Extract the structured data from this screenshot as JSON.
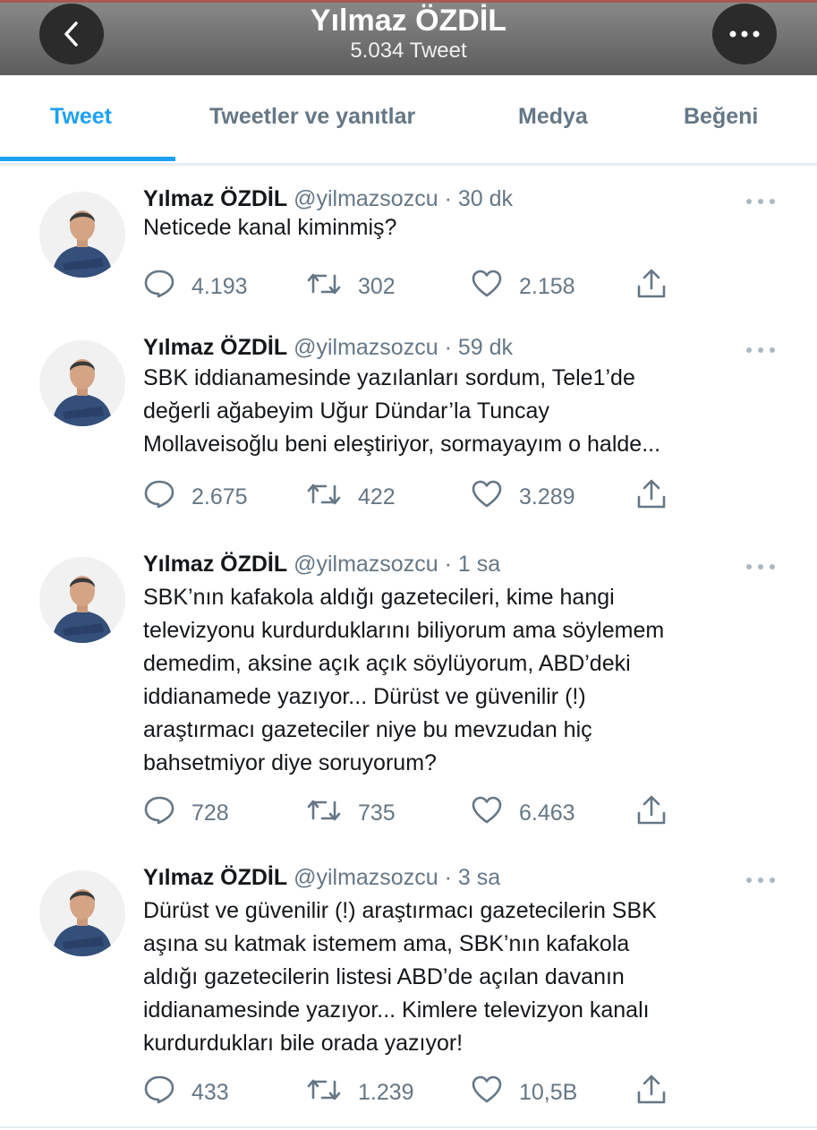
{
  "header": {
    "title": "Yılmaz ÖZDİL",
    "subtitle": "5.034 Tweet"
  },
  "tabs": [
    "Tweet",
    "Tweetler ve yanıtlar",
    "Medya",
    "Beğeni"
  ],
  "tweets": [
    {
      "name": "Yılmaz ÖZDİL",
      "handle": "@yilmazsozcu",
      "time": "30 dk",
      "lines": [
        "Neticede kanal kiminmiş?"
      ],
      "replies": "4.193",
      "retweets": "302",
      "likes": "2.158"
    },
    {
      "name": "Yılmaz ÖZDİL",
      "handle": "@yilmazsozcu",
      "time": "59 dk",
      "lines": [
        "SBK iddianamesinde yazılanları sordum, Tele1’de",
        "değerli ağabeyim Uğur Dündar’la Tuncay",
        "Mollaveisoğlu beni eleştiriyor, sormayayım o halde..."
      ],
      "replies": "2.675",
      "retweets": "422",
      "likes": "3.289"
    },
    {
      "name": "Yılmaz ÖZDİL",
      "handle": "@yilmazsozcu",
      "time": "1 sa",
      "lines": [
        "SBK’nın kafakola aldığı gazetecileri, kime hangi",
        "televizyonu kurdurduklarını biliyorum ama söylemem",
        "demedim, aksine açık açık söylüyorum, ABD’deki",
        "iddianamede yazıyor... Dürüst ve güvenilir (!)",
        "araştırmacı gazeteciler niye bu mevzudan hiç",
        "bahsetmiyor diye soruyorum?"
      ],
      "replies": "728",
      "retweets": "735",
      "likes": "6.463"
    },
    {
      "name": "Yılmaz ÖZDİL",
      "handle": "@yilmazsozcu",
      "time": "3 sa",
      "lines": [
        "Dürüst ve güvenilir (!) araştırmacı gazetecilerin SBK",
        "aşına su katmak istemem ama, SBK’nın kafakola",
        "aldığı gazetecilerin listesi ABD’de açılan davanın",
        "iddianamesinde yazıyor... Kimlere televizyon kanalı",
        "kurdurdukları bile orada yazıyor!"
      ],
      "replies": "433",
      "retweets": "1.239",
      "likes": "10,5B"
    }
  ],
  "colors": {
    "accent": "#1da1f2",
    "secondary": "#657786",
    "text": "#14171a",
    "divider": "#e6ecf0"
  },
  "icons": [
    "back-icon",
    "more-icon",
    "caret-icon",
    "reply-icon",
    "retweet-icon",
    "like-icon",
    "share-icon"
  ]
}
